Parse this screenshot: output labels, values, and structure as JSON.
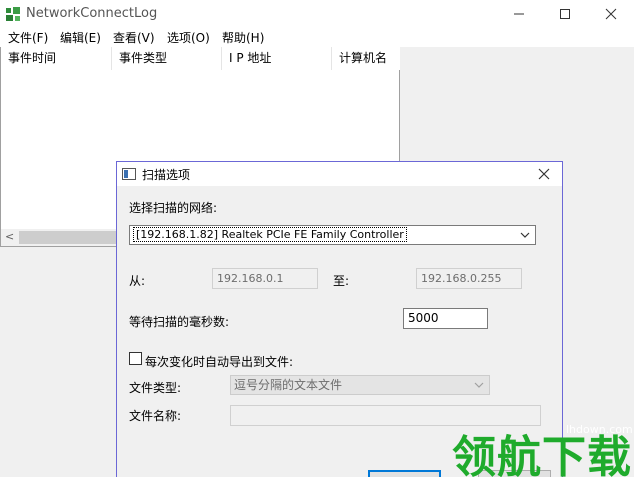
{
  "window": {
    "title": "NetworkConnectLog",
    "menu": [
      "文件(F)",
      "编辑(E)",
      "查看(V)",
      "选项(O)",
      "帮助(H)"
    ],
    "columns": [
      "事件时间",
      "事件类型",
      "I P 地址",
      "计算机名"
    ]
  },
  "dialog": {
    "title": "扫描选项",
    "network_label": "选择扫描的网络:",
    "network_value": "[192.168.1.82]  Realtek PCIe FE Family Controller",
    "from_label": "从:",
    "from_value": "192.168.0.1",
    "to_label": "至:",
    "to_value": "192.168.0.255",
    "wait_label": "等待扫描的毫秒数:",
    "wait_value": "5000",
    "export_label": "每次变化时自动导出到文件:",
    "export_checked": false,
    "filetype_label": "文件类型:",
    "filetype_value": "逗号分隔的文本文件",
    "filename_label": "文件名称:",
    "filename_value": ""
  },
  "watermark": {
    "text": "领航下载",
    "url": "lhdown.com"
  },
  "colors": {
    "dialog_border": "#6b67d6",
    "default_button": "#0078d7",
    "watermark": "#1fab2c"
  }
}
